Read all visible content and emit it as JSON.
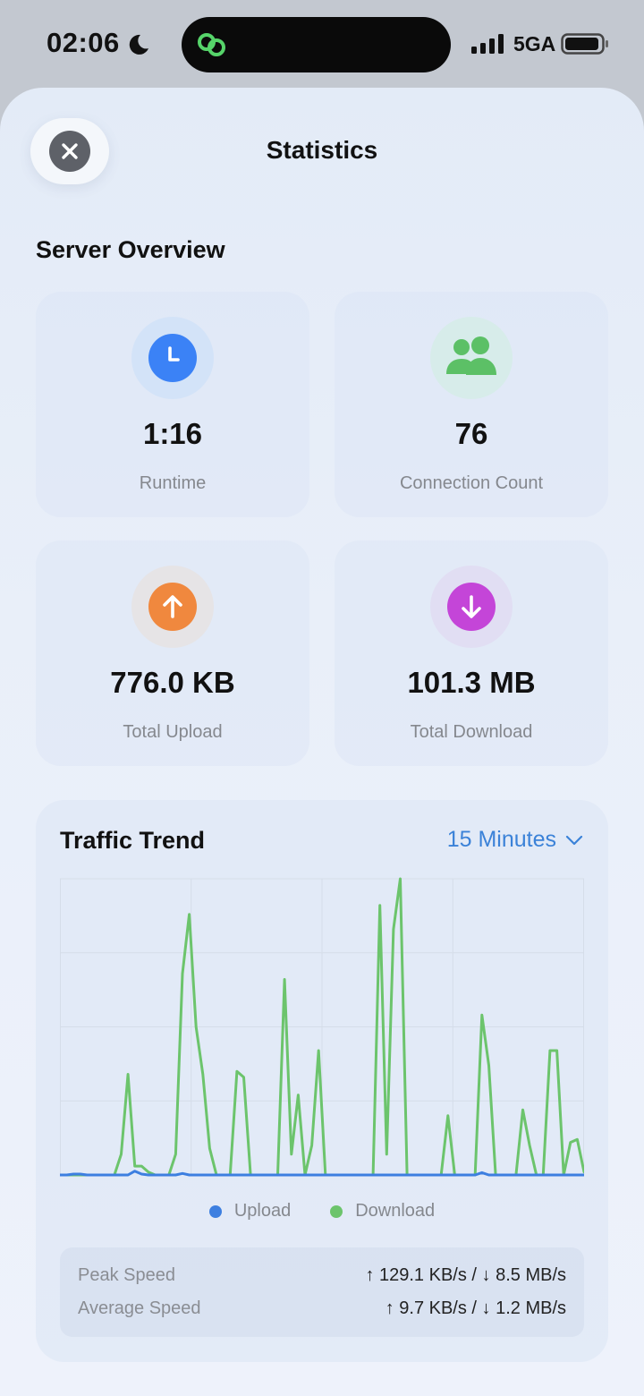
{
  "status_bar": {
    "time": "02:06",
    "network": "5GA"
  },
  "sheet": {
    "title": "Statistics"
  },
  "overview": {
    "title": "Server Overview",
    "cards": [
      {
        "value": "1:16",
        "label": "Runtime",
        "icon": "clock-icon",
        "color": "#3b82f6",
        "bg": "#d3e3f8"
      },
      {
        "value": "76",
        "label": "Connection Count",
        "icon": "users-icon",
        "color": "#5cc066",
        "bg": "#d7ecea"
      },
      {
        "value": "776.0 KB",
        "label": "Total Upload",
        "icon": "arrow-up-icon",
        "color": "#f0883e",
        "bg": "#e6e4e6"
      },
      {
        "value": "101.3 MB",
        "label": "Total Download",
        "icon": "arrow-down-icon",
        "color": "#c445d8",
        "bg": "#e1def3"
      }
    ]
  },
  "trend": {
    "title": "Traffic Trend",
    "range": "15 Minutes",
    "legend": {
      "upload": "Upload",
      "download": "Download"
    },
    "colors": {
      "upload": "#3d7fe0",
      "download": "#6cc46c"
    },
    "peak_label": "Peak Speed",
    "peak_value": "↑ 129.1 KB/s / ↓ 8.5 MB/s",
    "avg_label": "Average Speed",
    "avg_value": "↑ 9.7 KB/s / ↓ 1.2 MB/s"
  },
  "chart_data": {
    "type": "line",
    "ylim": [
      0,
      1
    ],
    "series": [
      {
        "name": "Download",
        "values": [
          0,
          0,
          0,
          0,
          0,
          0,
          0,
          0,
          0,
          0.07,
          0.34,
          0.03,
          0.03,
          0.01,
          0,
          0,
          0,
          0.07,
          0.68,
          0.88,
          0.5,
          0.34,
          0.09,
          0,
          0,
          0,
          0.35,
          0.33,
          0,
          0,
          0,
          0,
          0,
          0.66,
          0.07,
          0.27,
          0,
          0.1,
          0.42,
          0,
          0,
          0,
          0,
          0,
          0,
          0,
          0,
          0.91,
          0.07,
          0.83,
          1,
          0,
          0,
          0,
          0,
          0,
          0,
          0.2,
          0,
          0,
          0,
          0,
          0.54,
          0.37,
          0,
          0,
          0,
          0,
          0.22,
          0.1,
          0,
          0,
          0.42,
          0.42,
          0,
          0.11,
          0.12,
          0.01
        ]
      },
      {
        "name": "Upload",
        "values": [
          0,
          0,
          0.003,
          0.003,
          0,
          0,
          0,
          0,
          0,
          0,
          0,
          0.013,
          0.003,
          0,
          0,
          0,
          0,
          0,
          0.005,
          0,
          0,
          0,
          0,
          0,
          0,
          0,
          0,
          0,
          0,
          0,
          0,
          0,
          0,
          0,
          0,
          0,
          0,
          0,
          0,
          0,
          0,
          0,
          0,
          0,
          0,
          0,
          0,
          0,
          0,
          0,
          0,
          0,
          0,
          0,
          0,
          0,
          0,
          0,
          0,
          0,
          0,
          0,
          0.008,
          0,
          0,
          0,
          0,
          0,
          0,
          0,
          0,
          0,
          0,
          0,
          0,
          0,
          0,
          0
        ]
      }
    ]
  }
}
